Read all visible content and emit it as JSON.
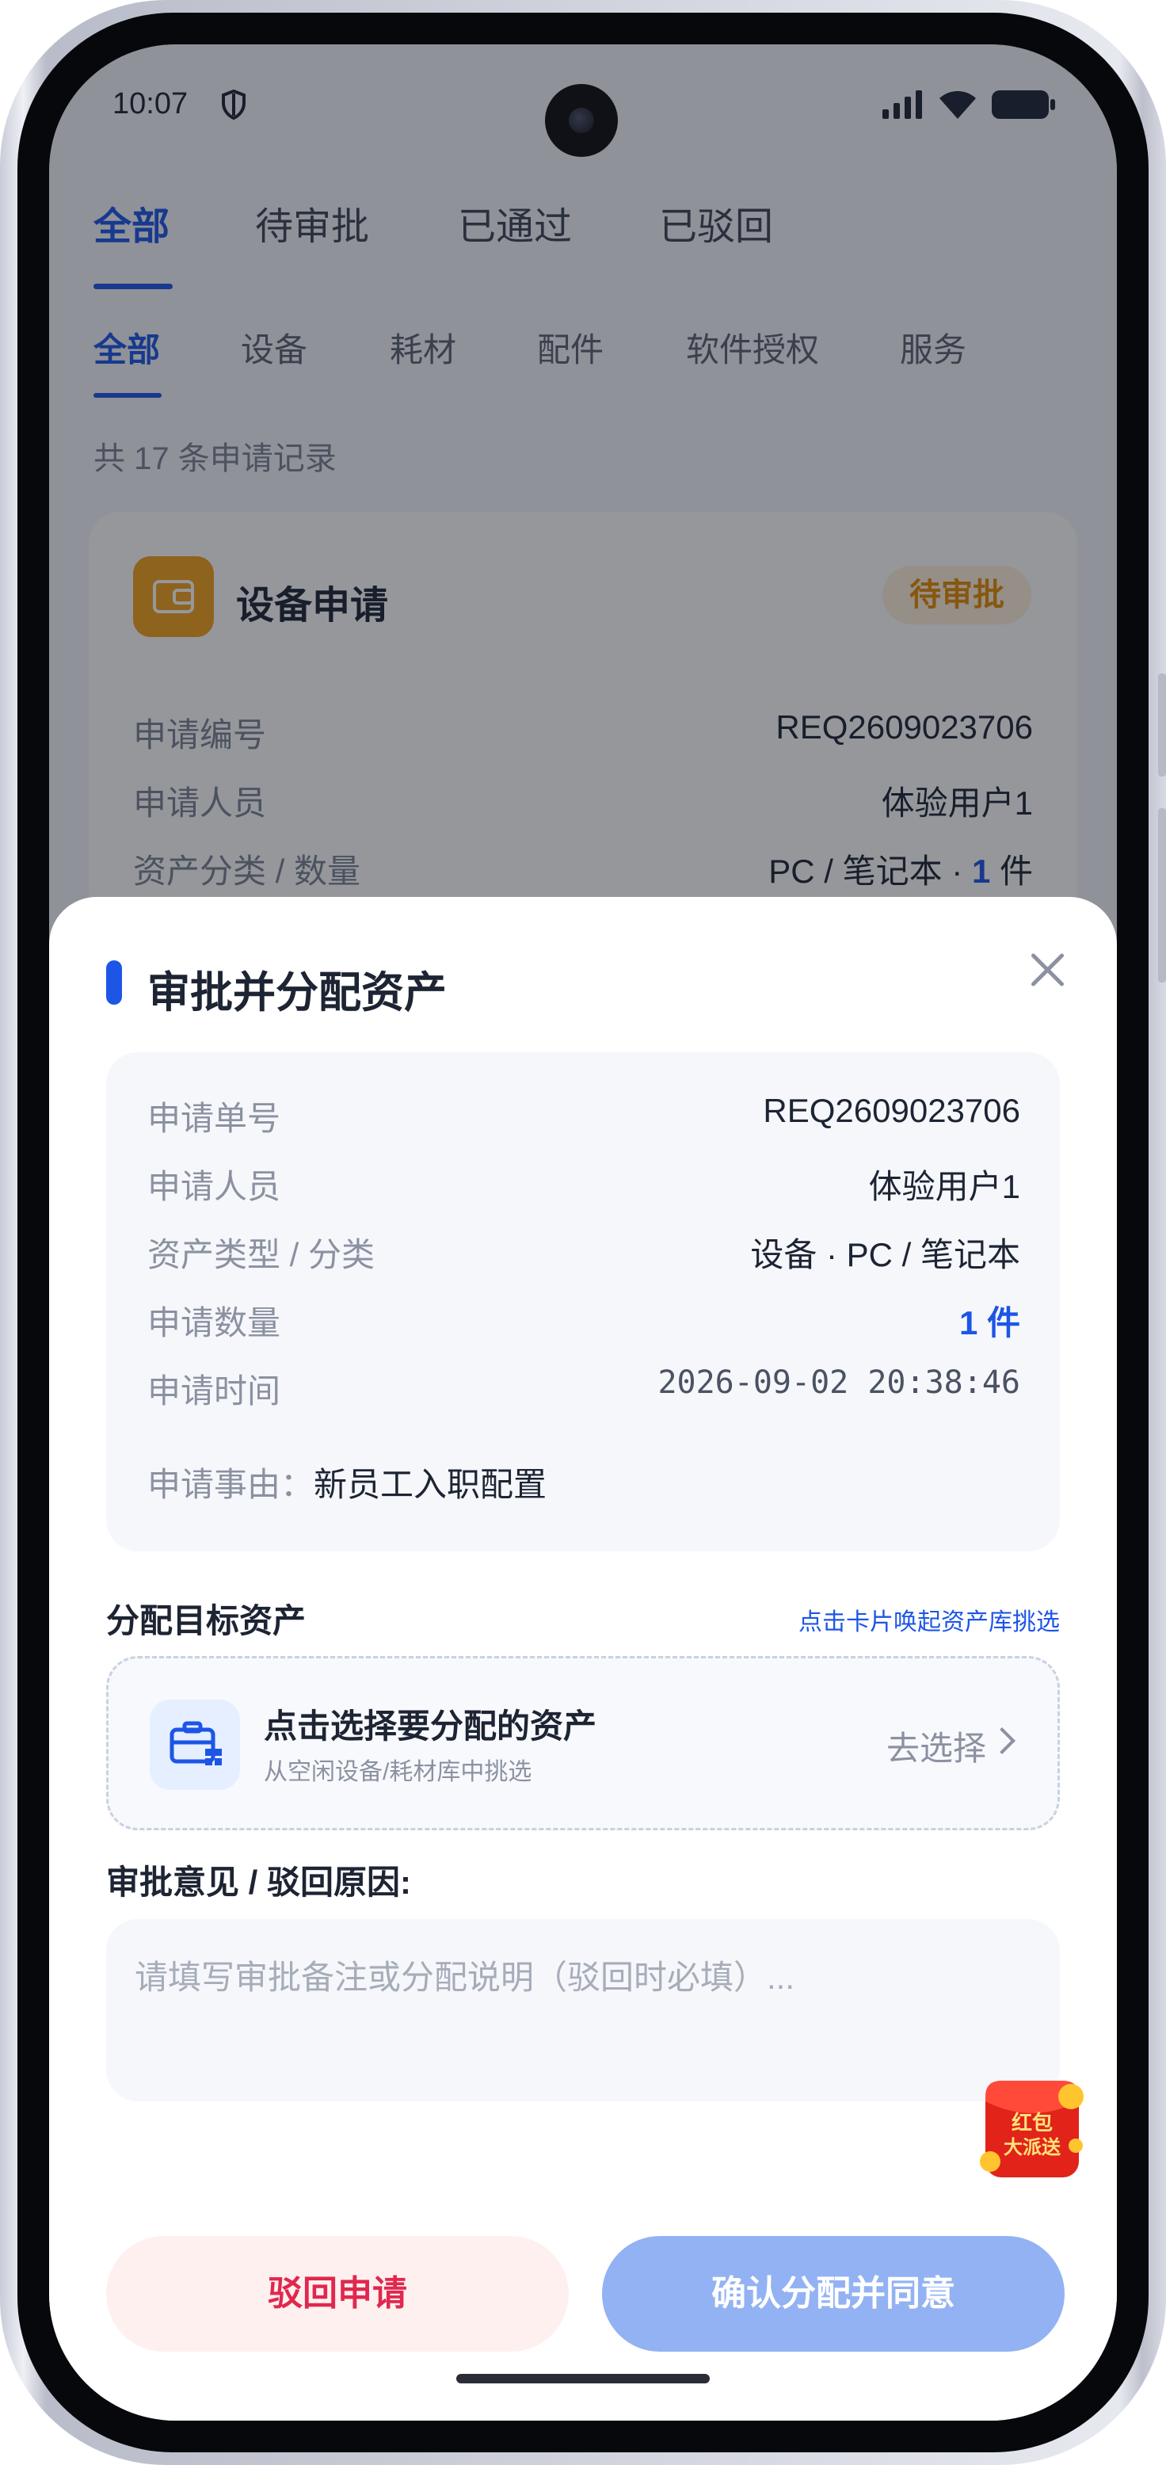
{
  "status_bar": {
    "time": "10:07"
  },
  "tabs_primary": [
    "全部",
    "待审批",
    "已通过",
    "已驳回"
  ],
  "tabs_secondary": [
    "全部",
    "设备",
    "耗材",
    "配件",
    "软件授权",
    "服务"
  ],
  "record_count": "共 17 条申请记录",
  "background_card": {
    "title": "设备申请",
    "badge": "待审批",
    "rows": [
      {
        "label": "申请编号",
        "value": "REQ2609023706"
      },
      {
        "label": "申请人员",
        "value": "体验用户1"
      },
      {
        "label": "资产分类 / 数量",
        "value_prefix": "PC / 笔记本 · ",
        "value_count": "1",
        "value_suffix": " 件"
      }
    ]
  },
  "sheet": {
    "title": "审批并分配资产",
    "info": {
      "rows": [
        {
          "label": "申请单号",
          "value": "REQ2609023706"
        },
        {
          "label": "申请人员",
          "value": "体验用户1"
        },
        {
          "label": "资产类型 / 分类",
          "value": "设备 · PC / 笔记本"
        },
        {
          "label": "申请数量",
          "value": "1 件"
        },
        {
          "label": "申请时间",
          "value": "2026-09-02 20:38:46"
        }
      ],
      "reason_label": "申请事由：",
      "reason_value": "新员工入职配置"
    },
    "assign_section": {
      "title": "分配目标资产",
      "hint": "点击卡片唤起资产库挑选",
      "select_title": "点击选择要分配的资产",
      "select_subtitle": "从空闲设备/耗材库中挑选",
      "select_action": "去选择"
    },
    "comment_section": {
      "title": "审批意见 / 驳回原因:",
      "placeholder": "请填写审批备注或分配说明（驳回时必填）..."
    },
    "red_envelope_text": [
      "红包",
      "大派送"
    ],
    "buttons": {
      "reject": "驳回申请",
      "confirm": "确认分配并同意"
    }
  },
  "colors": {
    "accent": "#1d55e6",
    "badge_orange": "#e58a00",
    "reject_red": "#e0284e",
    "confirm_disabled": "#93b2f3"
  }
}
